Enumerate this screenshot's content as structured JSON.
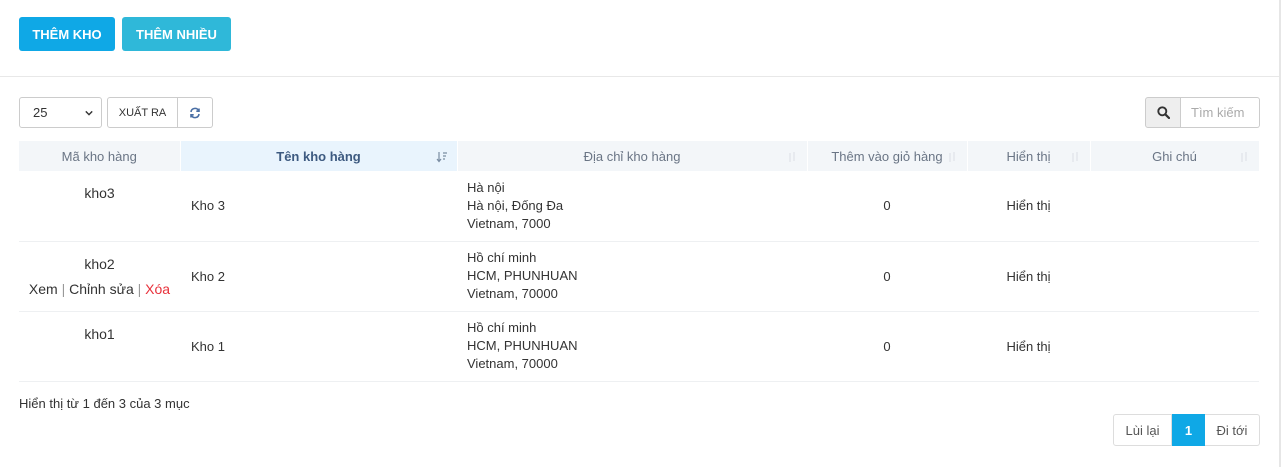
{
  "toolbar": {
    "add_label": "THÊM KHO",
    "add_many_label": "THÊM NHIỀU",
    "page_size": "25",
    "export_label": "XUẤT RA",
    "search_placeholder": "Tìm kiếm"
  },
  "table": {
    "headers": [
      "Mã kho hàng",
      "Tên kho hàng",
      "Địa chỉ kho hàng",
      "Thêm vào giỏ hàng",
      "Hiển thị",
      "Ghi chú"
    ],
    "rows": [
      {
        "code": "kho3",
        "name": "Kho 3",
        "address": [
          "Hà nội",
          "Hà nội, Đống Đa",
          "Vietnam, 7000"
        ],
        "add_to_cart": "0",
        "display": "Hiển thị",
        "note": ""
      },
      {
        "code": "kho2",
        "name": "Kho 2",
        "address": [
          "Hồ chí minh",
          "HCM, PHUNHUAN",
          "Vietnam, 70000"
        ],
        "add_to_cart": "0",
        "display": "Hiển thị",
        "note": "",
        "actions": {
          "view": "Xem",
          "edit": "Chỉnh sửa",
          "delete": "Xóa",
          "sep": "|"
        }
      },
      {
        "code": "kho1",
        "name": "Kho 1",
        "address": [
          "Hồ chí minh",
          "HCM, PHUNHUAN",
          "Vietnam, 70000"
        ],
        "add_to_cart": "0",
        "display": "Hiển thị",
        "note": ""
      }
    ]
  },
  "footer": {
    "info": "Hiển thị từ 1 đến 3 của 3 mục",
    "prev": "Lùi lại",
    "current": "1",
    "next": "Đi tới"
  },
  "colors": {
    "primary": "#0fa8e6",
    "secondary": "#2fb8d9",
    "danger": "#e8313b",
    "header_bg": "#f3f6f9"
  }
}
